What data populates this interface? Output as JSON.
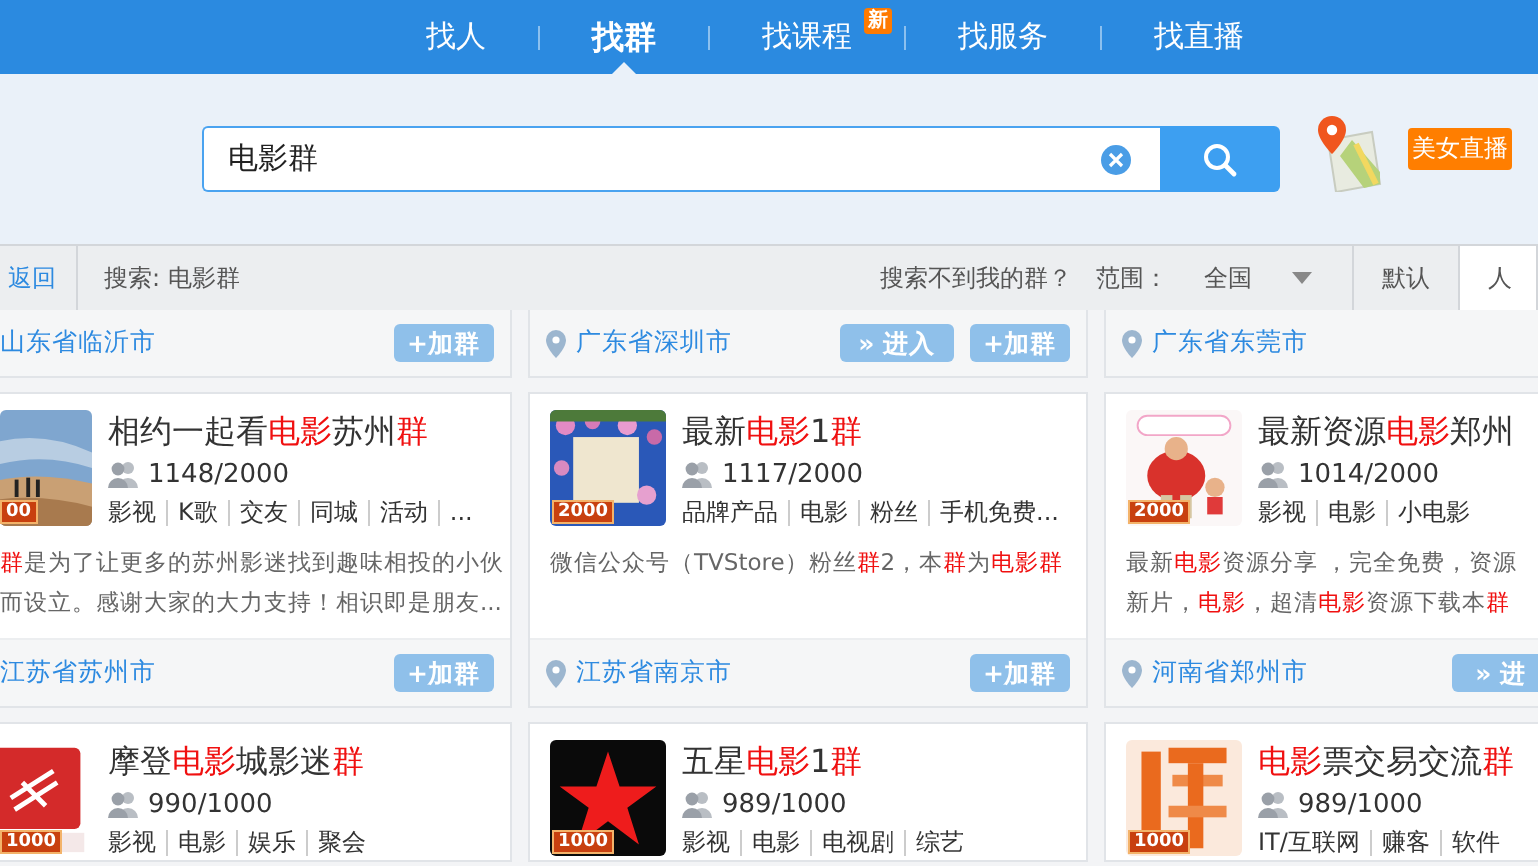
{
  "nav": {
    "items": [
      {
        "label": "找人",
        "selected": false
      },
      {
        "label": "找群",
        "selected": true
      },
      {
        "label": "找课程",
        "selected": false,
        "badge": "新"
      },
      {
        "label": "找服务",
        "selected": false
      },
      {
        "label": "找直播",
        "selected": false
      }
    ]
  },
  "search": {
    "value": "电影群"
  },
  "promo": {
    "label": "美女直播"
  },
  "toolbar": {
    "back": "返回",
    "query": "搜索: 电影群",
    "help": "搜索不到我的群？",
    "scope_label": "范围：",
    "scope": "全国",
    "sorts": [
      {
        "label": "默认",
        "selected": false
      },
      {
        "label": "人",
        "selected": true
      }
    ]
  },
  "rows": [
    [
      {
        "footer": {
          "pin": false,
          "location": "山东省临沂市",
          "buttons": [
            {
              "kind": "join",
              "label": "+加群"
            }
          ]
        }
      },
      {
        "footer": {
          "pin": true,
          "location": "广东省深圳市",
          "buttons": [
            {
              "kind": "enter",
              "label": "» 进入"
            },
            {
              "kind": "join",
              "label": "+加群"
            }
          ]
        }
      },
      {
        "footer": {
          "pin": true,
          "location": "广东省东莞市"
        }
      }
    ],
    [
      {
        "badge": "00",
        "title": [
          {
            "t": "相约一起看",
            "hl": false
          },
          {
            "t": "电影",
            "hl": true
          },
          {
            "t": "苏州",
            "hl": false
          },
          {
            "t": "群",
            "hl": true
          }
        ],
        "members": "1148/2000",
        "tags": [
          "影视",
          "K歌",
          "交友",
          "同城",
          "活动",
          "..."
        ],
        "description": [
          [
            {
              "t": "群",
              "hl": true
            },
            {
              "t": "是为了让更多的苏州影迷找到趣味相投的小伙",
              "hl": false
            }
          ],
          [
            {
              "t": "而设立。感谢大家的大力支持！相识即是朋友...",
              "hl": false
            }
          ]
        ],
        "footer": {
          "pin": false,
          "location": "江苏省苏州市",
          "buttons": [
            {
              "kind": "join",
              "label": "+加群"
            }
          ]
        }
      },
      {
        "badge": "2000",
        "title": [
          {
            "t": "最新",
            "hl": false
          },
          {
            "t": "电影",
            "hl": true
          },
          {
            "t": "1",
            "hl": false
          },
          {
            "t": "群",
            "hl": true
          }
        ],
        "members": "1117/2000",
        "tags": [
          "品牌产品",
          "电影",
          "粉丝",
          "手机免费..."
        ],
        "description": [
          [
            {
              "t": "微信公众号（TVStore）粉丝",
              "hl": false
            },
            {
              "t": "群",
              "hl": true
            },
            {
              "t": "2，本",
              "hl": false
            },
            {
              "t": "群",
              "hl": true
            },
            {
              "t": "为",
              "hl": false
            },
            {
              "t": "电影群",
              "hl": true
            }
          ]
        ],
        "footer": {
          "pin": true,
          "location": "江苏省南京市",
          "buttons": [
            {
              "kind": "join",
              "label": "+加群"
            }
          ]
        }
      },
      {
        "badge": "2000",
        "title": [
          {
            "t": "最新资源",
            "hl": false
          },
          {
            "t": "电影",
            "hl": true
          },
          {
            "t": "郑州",
            "hl": false
          }
        ],
        "members": "1014/2000",
        "tags": [
          "影视",
          "电影",
          "小电影"
        ],
        "description": [
          [
            {
              "t": "最新",
              "hl": false
            },
            {
              "t": "电影",
              "hl": true
            },
            {
              "t": "资源分享 ，完全免费，资源",
              "hl": false
            }
          ],
          [
            {
              "t": "新片，",
              "hl": false
            },
            {
              "t": "电影",
              "hl": true
            },
            {
              "t": "，超清",
              "hl": false
            },
            {
              "t": "电影",
              "hl": true
            },
            {
              "t": "资源下载本",
              "hl": false
            },
            {
              "t": "群",
              "hl": true
            }
          ]
        ],
        "footer": {
          "pin": true,
          "location": "河南省郑州市",
          "buttons": [
            {
              "kind": "enter",
              "label": "» 进"
            }
          ]
        }
      }
    ],
    [
      {
        "badge": "1000",
        "title": [
          {
            "t": "摩登",
            "hl": false
          },
          {
            "t": "电影",
            "hl": true
          },
          {
            "t": "城影迷",
            "hl": false
          },
          {
            "t": "群",
            "hl": true
          }
        ],
        "members": "990/1000",
        "tags": [
          "影视",
          "电影",
          "娱乐",
          "聚会"
        ]
      },
      {
        "badge": "1000",
        "title": [
          {
            "t": "五星",
            "hl": false
          },
          {
            "t": "电影",
            "hl": true
          },
          {
            "t": "1",
            "hl": false
          },
          {
            "t": "群",
            "hl": true
          }
        ],
        "members": "989/1000",
        "tags": [
          "影视",
          "电影",
          "电视剧",
          "综艺"
        ]
      },
      {
        "badge": "1000",
        "title": [
          {
            "t": "电影",
            "hl": true
          },
          {
            "t": "票交易交流",
            "hl": false
          },
          {
            "t": "群",
            "hl": true
          }
        ],
        "members": "989/1000",
        "tags": [
          "IT/互联网",
          "赚客",
          "软件"
        ]
      }
    ]
  ]
}
